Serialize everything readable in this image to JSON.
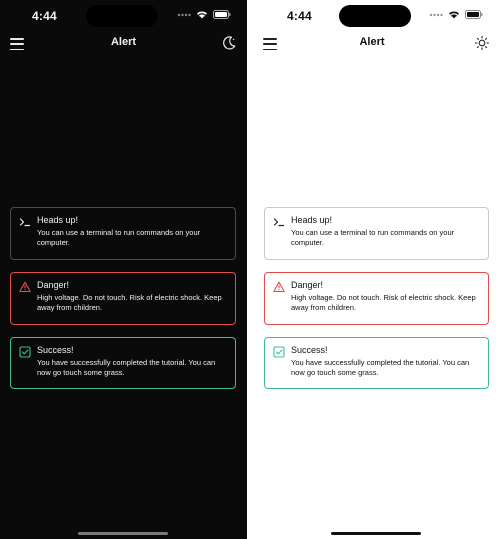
{
  "status": {
    "time": "4:44"
  },
  "nav": {
    "title": "Alert"
  },
  "alerts": {
    "info": {
      "title": "Heads up!",
      "description": "You can use a terminal to run commands on your computer.",
      "icon": "terminal-icon"
    },
    "danger": {
      "title": "Danger!",
      "description": "High voltage. Do not touch. Risk of electric shock. Keep away from children.",
      "icon": "warning-triangle-icon",
      "color": "#e34b4b"
    },
    "success": {
      "title": "Success!",
      "description": "You have successfully completed the tutorial. You can now go touch some grass.",
      "icon": "check-square-icon",
      "color": "#3fbf8f"
    }
  },
  "themes": {
    "dark": {
      "toggle_icon": "moon-icon",
      "background": "#0a0a0a"
    },
    "light": {
      "toggle_icon": "sun-icon",
      "background": "#ffffff"
    }
  }
}
